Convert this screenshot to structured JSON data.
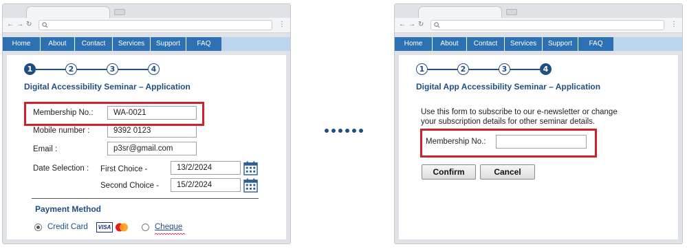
{
  "nav": {
    "items": [
      "Home",
      "About",
      "Contact",
      "Services",
      "Support",
      "FAQ"
    ]
  },
  "colors": {
    "nav_bar": "#2e71b2",
    "nav_bar_extension": "#bcd5ec",
    "title_blue": "#1f4e80",
    "highlight_red": "#d0202a"
  },
  "left_page": {
    "steps": {
      "labels": [
        "1",
        "2",
        "3",
        "4"
      ],
      "active": 1
    },
    "title": "Digital Accessibility Seminar – Application",
    "membership": {
      "label": "Membership No.:",
      "value": "WA-0021"
    },
    "mobile": {
      "label": "Mobile number :",
      "value": "9392 0123"
    },
    "email": {
      "label": "Email :",
      "value": "p3sr@gmail.com"
    },
    "date_selection": {
      "label": "Date Selection :",
      "first_choice": {
        "label": "First Choice -",
        "value": "13/2/2024"
      },
      "second_choice": {
        "label": "Second Choice -",
        "value": "15/2/2024"
      }
    },
    "payment": {
      "title": "Payment Method",
      "options": [
        {
          "label": "Credit Card",
          "selected": true,
          "card_logos": [
            "VISA",
            "mastercard"
          ]
        },
        {
          "label": "Cheque",
          "selected": false
        }
      ]
    }
  },
  "right_page": {
    "steps": {
      "labels": [
        "1",
        "2",
        "3",
        "4"
      ],
      "active": 4
    },
    "title": "Digital App Accessibility Seminar – Application",
    "description_line1": "Use this form to subscribe to our e-newsletter or change",
    "description_line2": "your subscription details for other seminar details.",
    "membership": {
      "label": "Membership No.:",
      "value": ""
    },
    "buttons": {
      "confirm": "Confirm",
      "cancel": "Cancel"
    }
  },
  "icons": [
    "search-icon",
    "back-arrow-icon",
    "forward-arrow-icon",
    "reload-icon",
    "menu-dots-icon",
    "calendar-icon",
    "visa-card-icon",
    "mastercard-icon",
    "ellipsis-icon"
  ]
}
